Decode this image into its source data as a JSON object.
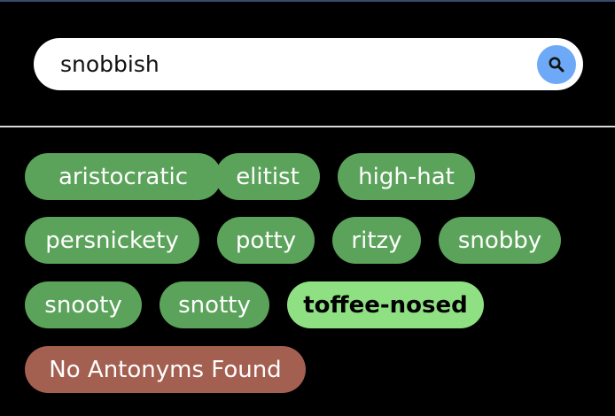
{
  "search": {
    "value": "snobbish",
    "button_icon": "search-icon"
  },
  "colors": {
    "background": "#000000",
    "synonym_tag": "#5ba35a",
    "selected_tag": "#8fe082",
    "antonym_tag": "#a35f50",
    "search_button": "#6ea9f7"
  },
  "synonyms": [
    {
      "label": "aristocratic"
    },
    {
      "label": "elitist"
    },
    {
      "label": "high-hat"
    },
    {
      "label": "persnickety"
    },
    {
      "label": "potty"
    },
    {
      "label": "ritzy"
    },
    {
      "label": "snobby"
    },
    {
      "label": "snooty"
    },
    {
      "label": "snotty"
    },
    {
      "label": "toffee-nosed",
      "selected": true
    }
  ],
  "antonyms": {
    "empty_label": "No Antonyms Found"
  }
}
